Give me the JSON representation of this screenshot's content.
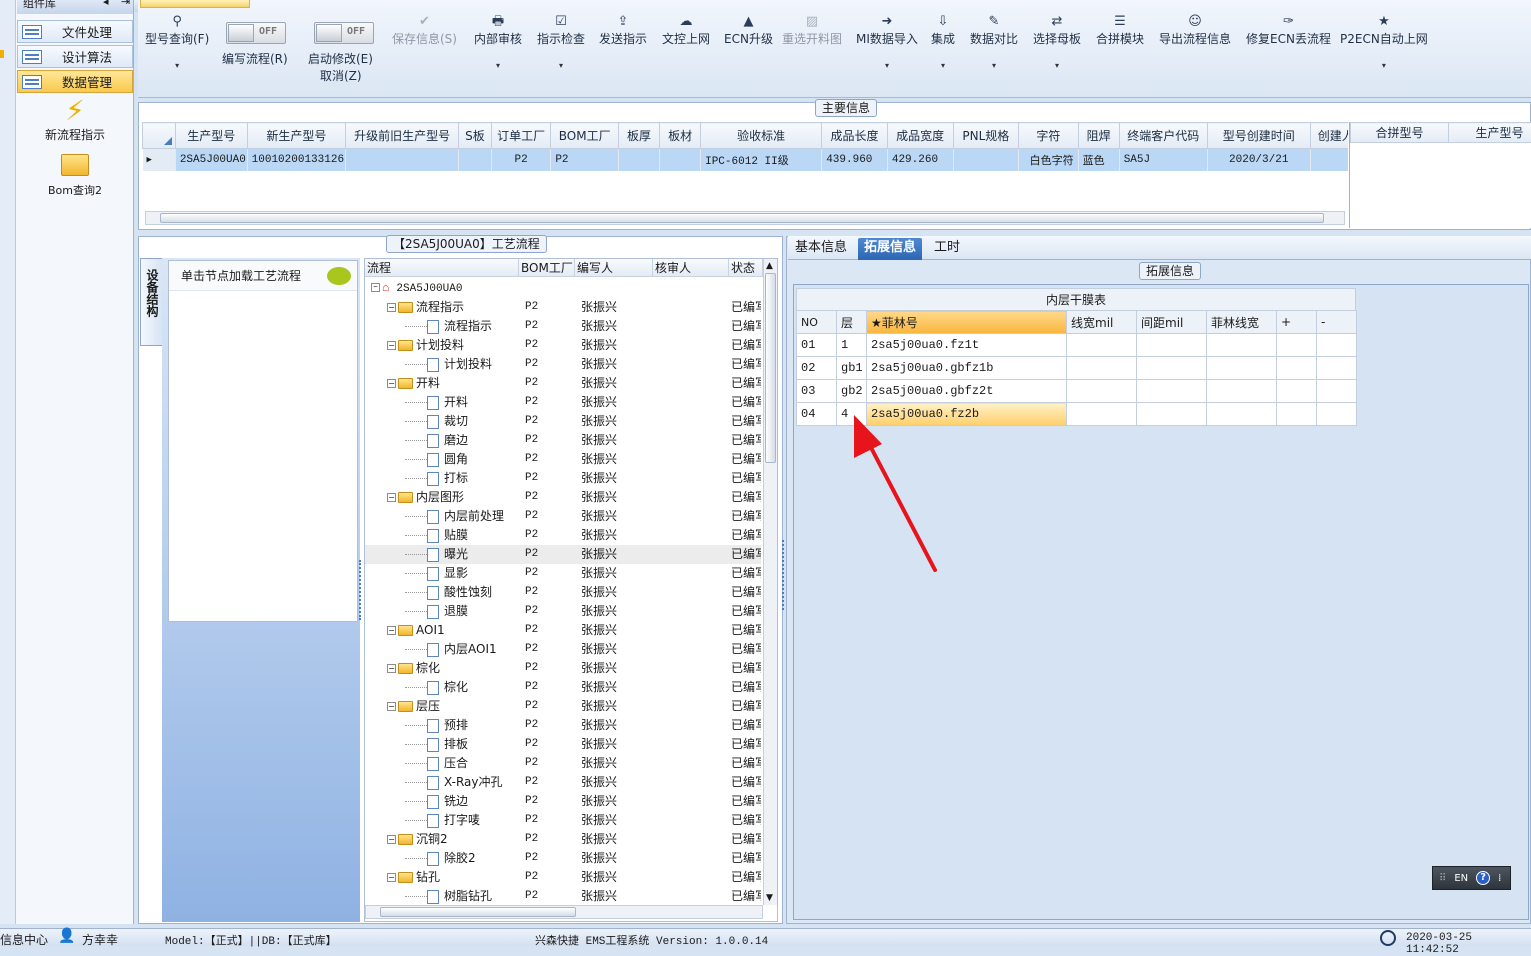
{
  "nav": {
    "lib_title": "组件库",
    "items": [
      {
        "label": "文件处理"
      },
      {
        "label": "设计算法"
      },
      {
        "label": "数据管理"
      }
    ],
    "big_items": [
      {
        "label": "新流程指示"
      },
      {
        "label": "Bom查询2"
      }
    ]
  },
  "toolbar": {
    "model_query": "型号查询(F)",
    "write_flow": "编写流程(R)",
    "startup_modify": "启动修改(E)",
    "cancel": "取消(Z)",
    "toggle_off": "OFF",
    "buttons": [
      {
        "label": "保存信息(S)",
        "icon": "✔",
        "disabled": true
      },
      {
        "label": "内部审核",
        "icon": "🖶"
      },
      {
        "label": "指示检查",
        "icon": "☑"
      },
      {
        "label": "发送指示",
        "icon": "⇪"
      },
      {
        "label": "文控上网",
        "icon": "☁"
      },
      {
        "label": "ECN升级",
        "icon": "▲"
      },
      {
        "label": "重选开料图",
        "icon": "▨",
        "disabled": true
      },
      {
        "label": "MI数据导入",
        "icon": "➜"
      },
      {
        "label": "集成",
        "icon": "⇩"
      },
      {
        "label": "数据对比",
        "icon": "✎"
      },
      {
        "label": "选择母板",
        "icon": "⇄"
      },
      {
        "label": "合拼模块",
        "icon": "☰"
      },
      {
        "label": "导出流程信息",
        "icon": "☺"
      },
      {
        "label": "修复ECN丢流程",
        "icon": "✑"
      },
      {
        "label": "P2ECN自动上网",
        "icon": "★"
      }
    ]
  },
  "main_info": {
    "title": "主要信息",
    "columns": [
      "生产型号",
      "新生产型号",
      "升级前旧生产型号",
      "S板",
      "订单工厂",
      "BOM工厂",
      "板厚",
      "板材",
      "验收标准",
      "成品长度",
      "成品宽度",
      "PNL规格",
      "字符",
      "阻焊",
      "终端客户代码",
      "型号创建时间",
      "创建人"
    ],
    "row": [
      "2SA5J00UA0",
      "10010200133126",
      "",
      "",
      "P2",
      "P2",
      "",
      "",
      "IPC-6012 II级",
      "439.960",
      "429.260",
      "",
      "白色字符",
      "蓝色",
      "SA5J",
      "2020/3/21",
      ""
    ],
    "side_columns": [
      "合拼型号",
      "生产型号"
    ]
  },
  "flow": {
    "title": "【2SA5J00UA0】工艺流程",
    "side_tab": "设备结构",
    "node_hint": "单击节点加载工艺流程",
    "columns": [
      "流程",
      "BOM工厂",
      "编写人",
      "核审人",
      "状态"
    ],
    "root": "2SA5J00UA0",
    "factory": "P2",
    "writer": "张振兴",
    "status": "已编写",
    "rows": [
      {
        "name": "流程指示",
        "folder": true
      },
      {
        "name": "流程指示",
        "folder": false
      },
      {
        "name": "计划投料",
        "folder": true
      },
      {
        "name": "计划投料",
        "folder": false
      },
      {
        "name": "开料",
        "folder": true
      },
      {
        "name": "开料",
        "folder": false
      },
      {
        "name": "裁切",
        "folder": false
      },
      {
        "name": "磨边",
        "folder": false
      },
      {
        "name": "圆角",
        "folder": false
      },
      {
        "name": "打标",
        "folder": false
      },
      {
        "name": "内层图形",
        "folder": true
      },
      {
        "name": "内层前处理",
        "folder": false
      },
      {
        "name": "贴膜",
        "folder": false
      },
      {
        "name": "曝光",
        "folder": false,
        "highlight": true
      },
      {
        "name": "显影",
        "folder": false
      },
      {
        "name": "酸性蚀刻",
        "folder": false
      },
      {
        "name": "退膜",
        "folder": false
      },
      {
        "name": "AOI1",
        "folder": true
      },
      {
        "name": "内层AOI1",
        "folder": false
      },
      {
        "name": "棕化",
        "folder": true
      },
      {
        "name": "棕化",
        "folder": false
      },
      {
        "name": "层压",
        "folder": true
      },
      {
        "name": "预排",
        "folder": false
      },
      {
        "name": "排板",
        "folder": false
      },
      {
        "name": "压合",
        "folder": false
      },
      {
        "name": "X-Ray冲孔",
        "folder": false
      },
      {
        "name": "铣边",
        "folder": false
      },
      {
        "name": "打字唛",
        "folder": false
      },
      {
        "name": "沉铜2",
        "folder": true
      },
      {
        "name": "除胶2",
        "folder": false
      },
      {
        "name": "钻孔",
        "folder": true
      },
      {
        "name": "树脂钻孔",
        "folder": false
      }
    ]
  },
  "right": {
    "tabs": [
      "基本信息",
      "拓展信息",
      "工时"
    ],
    "section_title": "拓展信息",
    "table_title": "内层干膜表",
    "columns": [
      "NO",
      "层",
      "★菲林号",
      "线宽mil",
      "间距mil",
      "菲林线宽",
      "+",
      "-"
    ],
    "rows": [
      [
        "01",
        "1",
        "2sa5j00ua0.fz1t",
        "",
        "",
        "",
        "",
        ""
      ],
      [
        "02",
        "gb1",
        "2sa5j00ua0.gbfz1b",
        "",
        "",
        "",
        "",
        ""
      ],
      [
        "03",
        "gb2",
        "2sa5j00ua0.gbfz2t",
        "",
        "",
        "",
        "",
        ""
      ],
      [
        "04",
        "4",
        "2sa5j00ua0.fz2b",
        "",
        "",
        "",
        "",
        ""
      ]
    ],
    "ime": "EN"
  },
  "status": {
    "info_center": "信息中心",
    "user": "方幸幸",
    "model": "Model:【正式】||DB:【正式库】",
    "system": "兴森快捷 EMS工程系统 Version: 1.0.0.14",
    "datetime": "2020-03-25 11:42:52"
  },
  "colors": {
    "accent": "#2d66b5",
    "selection": "#bad8f5",
    "highlight": "#f9b53d",
    "arrow": "#e8141b"
  }
}
